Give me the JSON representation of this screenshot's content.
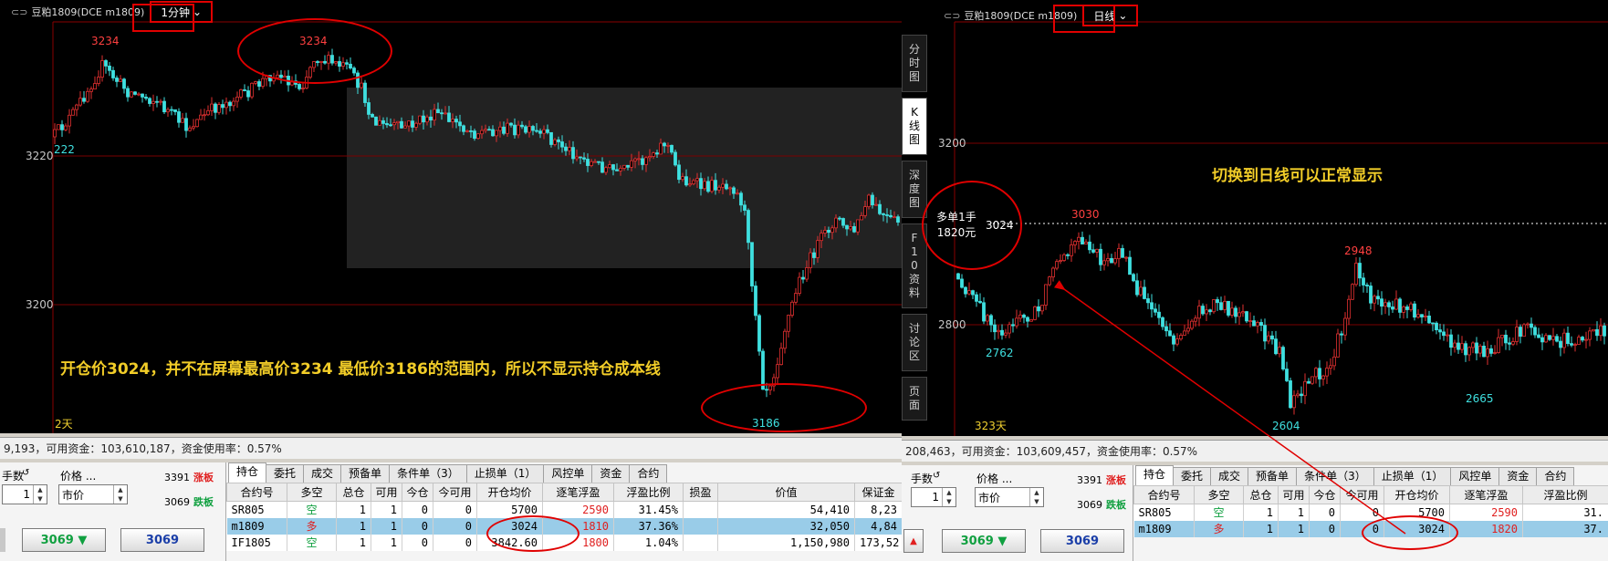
{
  "left": {
    "title": "豆粕1809(DCE m1809)",
    "period": "1分钟",
    "y_ticks": [
      "3220",
      "3200"
    ],
    "labels": {
      "high_a": "3234",
      "high_b": "3234",
      "low": "3186",
      "left_edge": "222",
      "days": "2天"
    },
    "annotation": "开仓价3024，并不在屏幕最高价3234 最低价3186的范围内，所以不显示持仓成本线",
    "status": "9,193，可用资金：103,610,187，资金使用率：0.57%",
    "order": {
      "qty_label": "手数",
      "qty": "1",
      "price_label": "价格 ...",
      "price_type": "市价",
      "limit_up_value": "3391",
      "limit_up_label": "涨板",
      "limit_down_value": "3069",
      "limit_down_label": "跌板",
      "btn_sell": "3069 ▼",
      "btn_buy": "3069"
    },
    "tabs": [
      "持仓",
      "委托",
      "成交",
      "预备单",
      "条件单（3）",
      "止损单（1）",
      "风控单",
      "资金",
      "合约"
    ],
    "columns": [
      "合约号",
      "多空",
      "总仓",
      "可用",
      "今仓",
      "今可用",
      "开仓均价",
      "逐笔浮盈",
      "浮盈比例",
      "损盈",
      "价值",
      "保证金"
    ],
    "rows": [
      [
        "SR805",
        "空",
        "1",
        "1",
        "0",
        "0",
        "5700",
        "2590",
        "31.45%",
        "",
        "54,410",
        "8,23"
      ],
      [
        "m1809",
        "多",
        "1",
        "1",
        "0",
        "0",
        "3024",
        "1810",
        "37.36%",
        "",
        "32,050",
        "4,84"
      ],
      [
        "IF1805",
        "空",
        "1",
        "1",
        "0",
        "0",
        "3842.60",
        "1800",
        "1.04%",
        "",
        "1,150,980",
        "173,52"
      ]
    ]
  },
  "right": {
    "title": "豆粕1809(DCE m1809)",
    "period": "日线",
    "side_tabs": [
      "分时图",
      "K线图",
      "深度图",
      "F10资料",
      "讨论区",
      "页面"
    ],
    "y_ticks": [
      "3200",
      "2800"
    ],
    "labels": {
      "high": "3030",
      "mid_high": "2948",
      "low_a": "2762",
      "low_b": "2604",
      "low_c": "2665",
      "days": "323天"
    },
    "position_note": {
      "line1": "多单1手",
      "line2": "1820元",
      "price": "3024"
    },
    "annotation": "切换到日线可以正常显示",
    "status": "208,463，可用资金：103,609,457，资金使用率：0.57%",
    "order": {
      "qty_label": "手数",
      "qty": "1",
      "price_label": "价格 ...",
      "price_type": "市价",
      "limit_up_value": "3391",
      "limit_up_label": "涨板",
      "limit_down_value": "3069",
      "limit_down_label": "跌板",
      "btn_sell": "3069 ▼",
      "btn_buy": "3069"
    },
    "tabs": [
      "持仓",
      "委托",
      "成交",
      "预备单",
      "条件单（3）",
      "止损单（1）",
      "风控单",
      "资金",
      "合约"
    ],
    "columns": [
      "合约号",
      "多空",
      "总仓",
      "可用",
      "今仓",
      "今可用",
      "开仓均价",
      "逐笔浮盈",
      "浮盈比例"
    ],
    "rows": [
      [
        "SR805",
        "空",
        "1",
        "1",
        "0",
        "0",
        "5700",
        "2590",
        "31."
      ],
      [
        "m1809",
        "多",
        "1",
        "1",
        "0",
        "0",
        "3024",
        "1820",
        "37."
      ]
    ]
  },
  "icons": [
    "chain-icon",
    "chevron-down-icon",
    "spin-arrows-icon",
    "sell-arrow-icon",
    "red-circle-annotation",
    "red-arrow-annotation"
  ],
  "colors": {
    "up": "#e03030",
    "down": "#3fe0e0",
    "annotation": "#f2cd28",
    "highlight": "#e00000",
    "selected_row": "#99cce8"
  }
}
